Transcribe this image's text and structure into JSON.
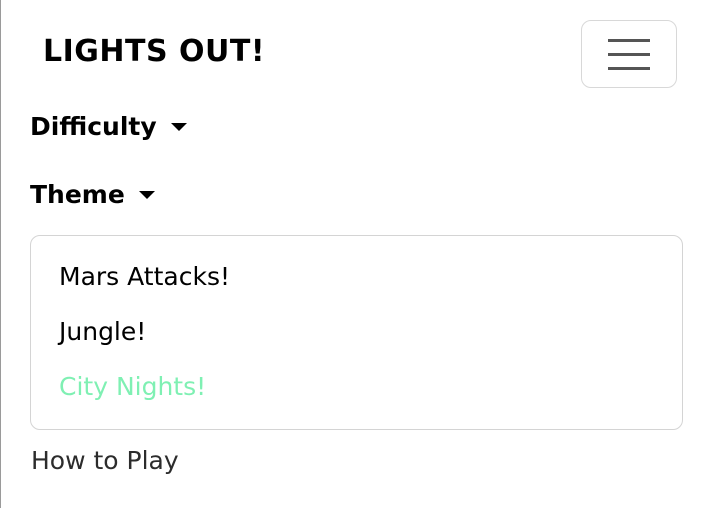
{
  "brand": {
    "title": "LIGHTS OUT!"
  },
  "navbar": {
    "toggler_icon": "hamburger-icon"
  },
  "menu": {
    "difficulty_label": "Difficulty",
    "theme_label": "Theme",
    "theme_options": [
      "Mars Attacks!",
      "Jungle!",
      "City Nights!"
    ],
    "active_theme_color": "#7ff0b3",
    "how_to_play_label": "How to Play"
  }
}
